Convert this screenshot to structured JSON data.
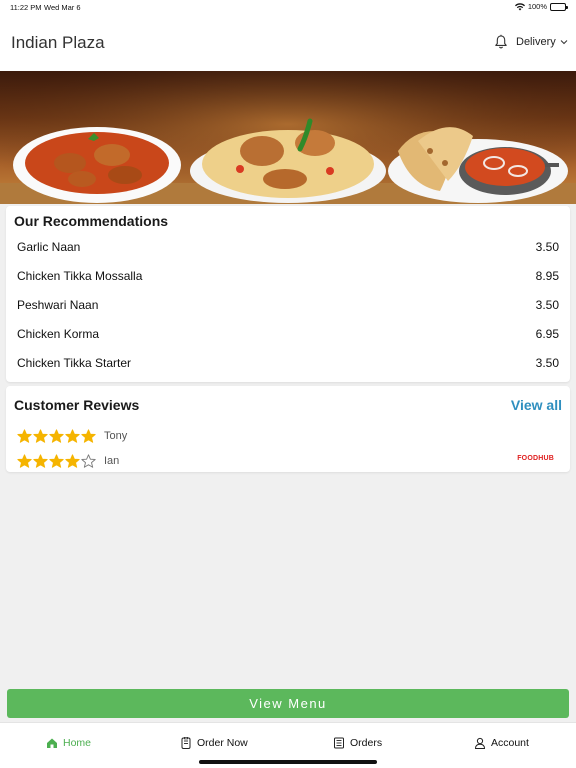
{
  "status_bar": {
    "time": "11:22 PM",
    "date": "Wed Mar 6",
    "battery": "100%",
    "battery_level": 1.0
  },
  "header": {
    "title": "Indian Plaza",
    "delivery_label": "Delivery",
    "icons": [
      "bell-icon",
      "chevron-down-icon"
    ]
  },
  "recommendations": {
    "title": "Our Recommendations",
    "items": [
      {
        "name": "Garlic Naan",
        "price": "3.50"
      },
      {
        "name": "Chicken Tikka Mossalla",
        "price": "8.95"
      },
      {
        "name": "Peshwari Naan",
        "price": "3.50"
      },
      {
        "name": "Chicken Korma",
        "price": "6.95"
      },
      {
        "name": "Chicken Tikka Starter",
        "price": "3.50"
      }
    ]
  },
  "reviews": {
    "title": "Customer Reviews",
    "view_all": "View all",
    "items": [
      {
        "name": "Tony",
        "rating": 5
      },
      {
        "name": "Ian",
        "rating": 4
      }
    ],
    "source_logo": "FOODHUB"
  },
  "view_menu_label": "View Menu",
  "tabs": [
    {
      "label": "Home",
      "icon": "home-icon",
      "active": true
    },
    {
      "label": "Order Now",
      "icon": "order-icon",
      "active": false
    },
    {
      "label": "Orders",
      "icon": "receipt-icon",
      "active": false
    },
    {
      "label": "Account",
      "icon": "user-icon",
      "active": false
    }
  ],
  "colors": {
    "accent_green": "#5cb85c",
    "link_blue": "#2f8fbf",
    "star_gold": "#f5b400",
    "brand_red": "#e02020"
  }
}
